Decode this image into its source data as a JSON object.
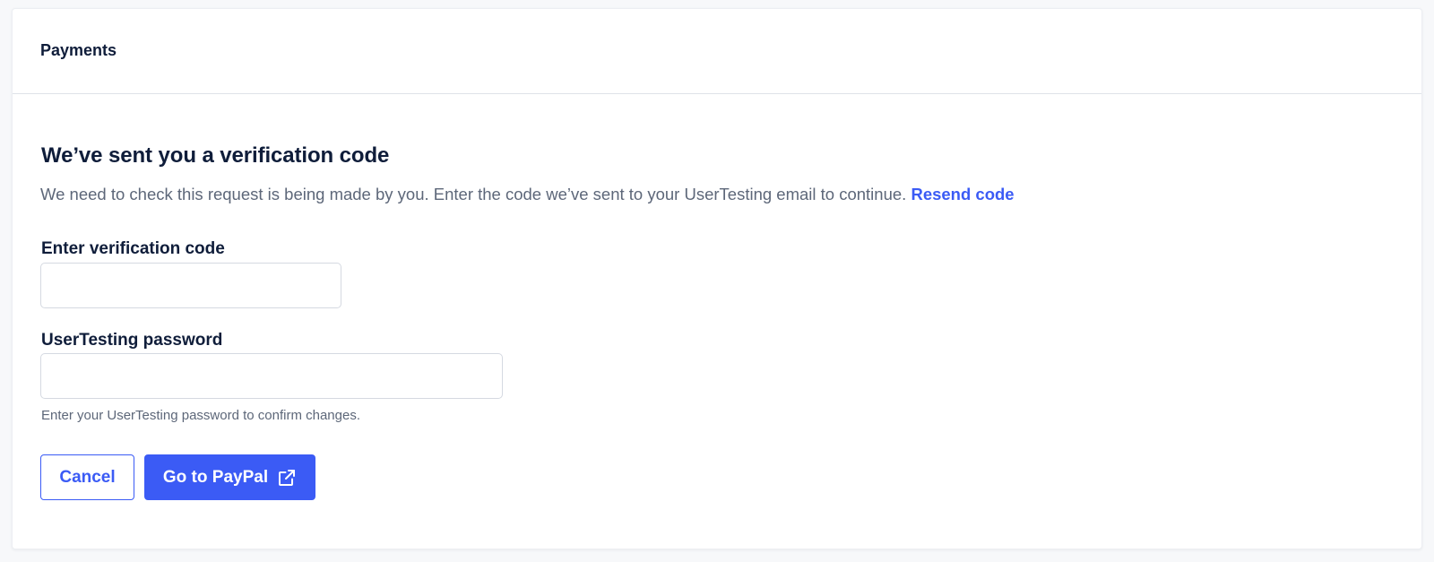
{
  "header": {
    "title": "Payments"
  },
  "verification": {
    "heading": "We’ve sent you a verification code",
    "description": "We need to check this request is being made by you. Enter the code we’ve sent to your UserTesting email to continue.",
    "resend_label": "Resend code"
  },
  "form": {
    "code_label": "Enter verification code",
    "code_value": "",
    "code_placeholder": "",
    "password_label": "UserTesting password",
    "password_value": "",
    "password_placeholder": "",
    "password_help": "Enter your UserTesting password to confirm changes."
  },
  "actions": {
    "cancel_label": "Cancel",
    "primary_label": "Go to PayPal",
    "primary_icon": "external-link-icon"
  },
  "colors": {
    "accent": "#3b5bf5",
    "heading_text": "#0f1d3a",
    "body_text": "#5d6779",
    "border": "#d5d9e1"
  }
}
